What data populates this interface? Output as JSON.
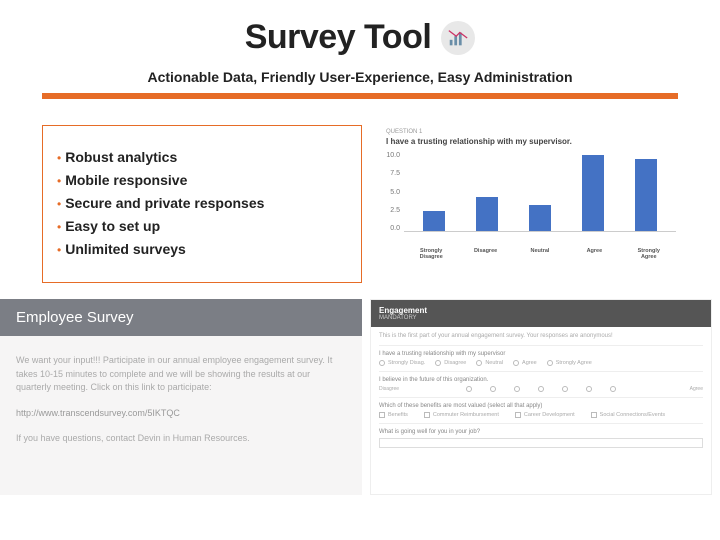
{
  "header": {
    "title": "Survey Tool",
    "subtitle": "Actionable Data, Friendly User-Experience, Easy Administration"
  },
  "features": {
    "items": [
      {
        "strong": "Robust",
        "rest": " analytics"
      },
      {
        "strong": "Mobile",
        "rest": " responsive"
      },
      {
        "strong": "Secure",
        "rest": " and private responses"
      },
      {
        "strong": "Easy",
        "rest": " to set up"
      },
      {
        "strong": "Unlimited",
        "rest": " surveys"
      }
    ]
  },
  "chart_data": {
    "type": "bar",
    "top_label": "QUESTION 1",
    "title": "I have a trusting relationship with my supervisor.",
    "categories": [
      "Strongly Disagree",
      "Disagree",
      "Neutral",
      "Agree",
      "Strongly Agree"
    ],
    "values": [
      2.5,
      4.2,
      3.2,
      9.5,
      9.0
    ],
    "ylabel": "",
    "ylim": [
      0,
      10
    ],
    "yticks": [
      "10.0",
      "7.5",
      "5.0",
      "2.5",
      "0.0"
    ]
  },
  "email": {
    "title": "Employee Survey",
    "line1": "We want your input!!! Participate in our annual employee engagement survey. It takes 10-15 minutes to complete and we will be showing the results at our quarterly meeting. Click on this link to participate:",
    "link": "http://www.transcendsurvey.com/5IKTQC",
    "line2": "If you have questions, contact Devin in Human Resources."
  },
  "form": {
    "title": "Engagement",
    "subtitle": "MANDATORY",
    "intro": "This is the first part of your annual engagement survey. Your responses are anonymous!",
    "q1": {
      "text": "I have a trusting relationship with my supervisor",
      "options": [
        "Strongly Disag.",
        "Disagree",
        "Neutral",
        "Agree",
        "Strongly Agree"
      ]
    },
    "q2": {
      "text": "I believe in the future of this organization.",
      "left": "Disagree",
      "right": "Agree"
    },
    "q3": {
      "text": "Which of these benefits are most valued (select all that apply)",
      "options": [
        "Benefits",
        "Commuter Reimbursement",
        "Career Development",
        "Social Connections/Events"
      ]
    },
    "q4": {
      "text": "What is going well for you in your job?"
    }
  }
}
